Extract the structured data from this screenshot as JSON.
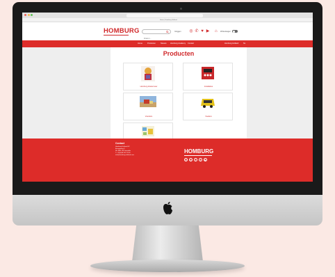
{
  "browser": {
    "url": "www.homburg-holland.com",
    "tab_title": "Home | Homburg Holland",
    "traffic_colors": [
      "#ee5f57",
      "#f5bd4f",
      "#61c455"
    ]
  },
  "header": {
    "logo_text": "HOMBURG",
    "search_placeholder": "Zoeken...",
    "account_label": "Inloggen",
    "cart_label": "Winkelwagen",
    "social_icons": [
      "instagram-icon",
      "phone-icon",
      "twitter-icon",
      "youtube-icon"
    ]
  },
  "nav": {
    "items": [
      {
        "label": "Home"
      },
      {
        "label": "Producten"
      },
      {
        "label": "Nieuws"
      },
      {
        "label": "Homburg Academy"
      },
      {
        "label": "Contact"
      },
      {
        "label": "Homburg Holland"
      },
      {
        "label": "NL"
      }
    ]
  },
  "main": {
    "title": "Producten",
    "products": [
      {
        "label": "Homburg Zoetermeer"
      },
      {
        "label": "Installaties"
      },
      {
        "label": "Voerders"
      },
      {
        "label": "Voeders"
      },
      {
        "label": "Uitvoer & Voorraadkosten"
      }
    ]
  },
  "footer": {
    "contact_title": "Contact",
    "lines": [
      "Homburg Holland BV",
      "Energieweg 3",
      "NL-3891 XB Zeewolde",
      "T: +31(0)36 522 78 00",
      "info@homburg-holland.com"
    ],
    "logo_text": "HOMBURG",
    "social_icons": [
      "instagram-icon",
      "linkedin-icon",
      "twitter-icon",
      "facebook-icon",
      "youtube-icon"
    ]
  },
  "colors": {
    "brand_red": "#dd2c29",
    "background": "#fbe9e4"
  }
}
